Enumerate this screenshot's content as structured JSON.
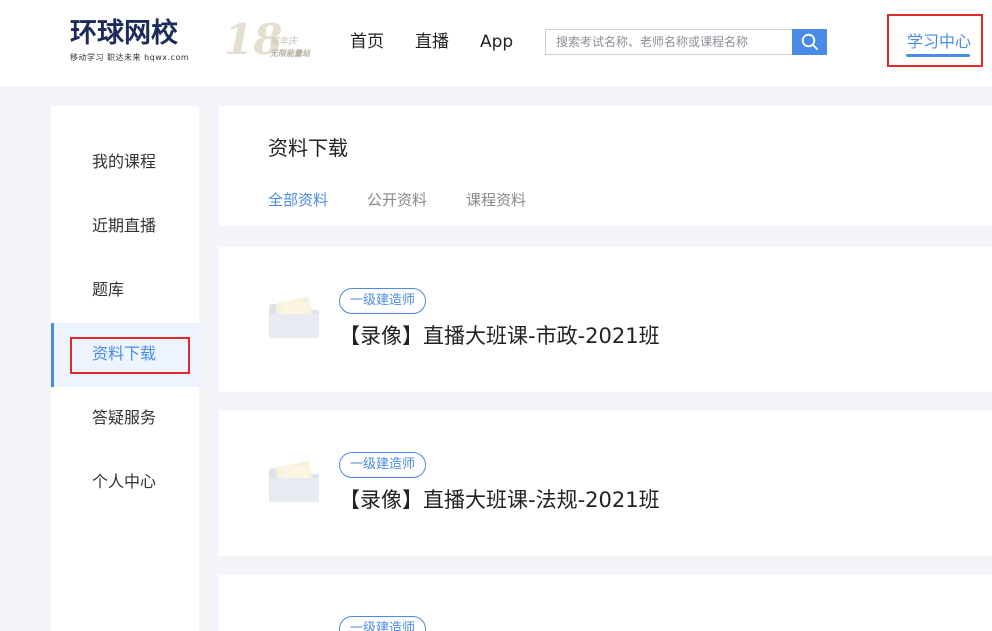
{
  "header": {
    "logo_text": "环球网校",
    "logo_sub": "移动学习 职达未来  hqwx.com",
    "badge_number": "18",
    "badge_line1": "周年庆",
    "badge_line2": "无限能量站",
    "nav": [
      "首页",
      "直播",
      "App"
    ],
    "search_placeholder": "搜索考试名称、老师名称或课程名称",
    "study_center": "学习中心"
  },
  "sidebar": {
    "items": [
      {
        "label": "我的课程"
      },
      {
        "label": "近期直播"
      },
      {
        "label": "题库"
      },
      {
        "label": "资料下载"
      },
      {
        "label": "答疑服务"
      },
      {
        "label": "个人中心"
      }
    ],
    "active_index": 3
  },
  "main": {
    "title": "资料下载",
    "tabs": [
      "全部资料",
      "公开资料",
      "课程资料"
    ],
    "active_tab": 0,
    "cards": [
      {
        "tag": "一级建造师",
        "title": "【录像】直播大班课-市政-2021班"
      },
      {
        "tag": "一级建造师",
        "title": "【录像】直播大班课-法规-2021班"
      },
      {
        "tag": "一级建造师",
        "title": ""
      }
    ]
  },
  "colors": {
    "accent": "#4a8be8",
    "highlight": "#e12b2b",
    "background": "#f4f5f9"
  }
}
